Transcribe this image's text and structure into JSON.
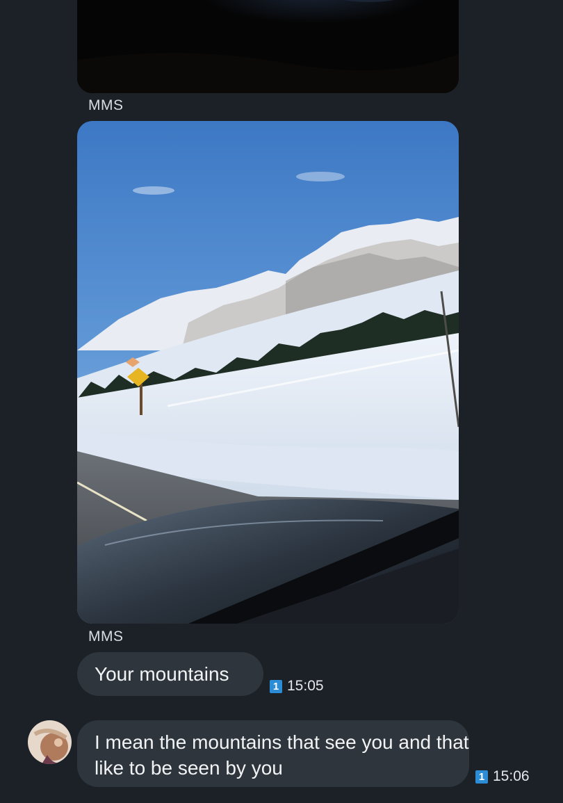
{
  "conversation": {
    "messages": [
      {
        "type": "mms",
        "label": "MMS",
        "image": "dark-night-photo"
      },
      {
        "type": "mms",
        "label": "MMS",
        "image": "snowy-mountain-road-photo"
      },
      {
        "type": "text",
        "text": "Your mountains",
        "sim": "1",
        "time": "15:05"
      },
      {
        "type": "text",
        "text": "I mean the mountains that see you and that like to be seen by you",
        "sim": "1",
        "time": "15:06",
        "avatar": "contact-avatar"
      }
    ]
  },
  "colors": {
    "background": "#1b2127",
    "bubble": "#2e353c",
    "sim_badge": "#2d8cd6"
  },
  "icons": {
    "sim_badge": "sim-1-icon"
  }
}
